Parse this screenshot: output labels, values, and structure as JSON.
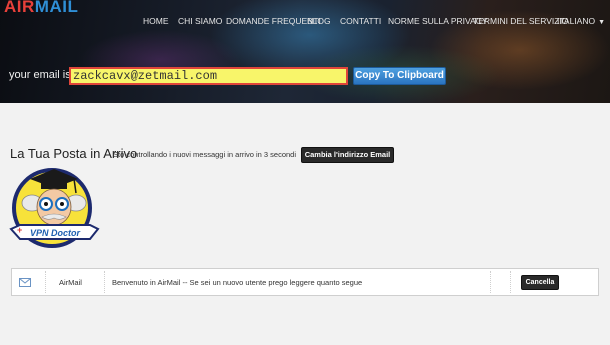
{
  "logo": {
    "part1": "AIR",
    "part2": "MAIL"
  },
  "nav": {
    "items": [
      "HOME",
      "CHI SIAMO",
      "DOMANDE FREQUENTI",
      "BLOG",
      "CONTATTI",
      "NORME SULLA PRIVACY",
      "TERMINI DEL SERVIZIO"
    ],
    "language": "ITALIANO"
  },
  "email_bar": {
    "label": "your email is :",
    "value": "zackcavx@zetmail.com",
    "copy_button": "Copy To Clipboard"
  },
  "inbox": {
    "title": "La Tua Posta in Arrivo",
    "status": "Sto controllando i nuovi messaggi in arrivo in 3 secondi",
    "change_button": "Cambia l'indirizzo Email"
  },
  "mascot": {
    "badge_text": "VPN Doctor",
    "icon": "vpn-doctor-mascot-icon"
  },
  "messages": [
    {
      "icon": "envelope-icon",
      "from": "AirMail",
      "subject": "Benvenuto in AirMail -- Se sei un nuovo utente prego leggere quanto segue",
      "delete_button": "Cancella"
    }
  ],
  "colors": {
    "logo_red": "#e8403a",
    "logo_blue": "#2f8fd6",
    "email_highlight": "#f8f56a",
    "email_border": "#e0453a",
    "copy_button": "#2a74c0",
    "dark_button": "#2a2a2a"
  }
}
